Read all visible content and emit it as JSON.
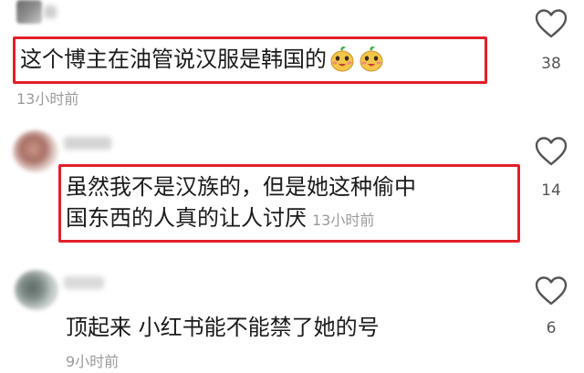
{
  "comments": [
    {
      "text": "这个博主在油管说汉服是韩国的",
      "emoji": [
        "happy-mascot-icon",
        "happy-mascot-icon"
      ],
      "time": "13小时前",
      "likes": "38"
    },
    {
      "line1": "虽然我不是汉族的，但是她这种偷中",
      "line2": "国东西的人真的让人讨厌",
      "time": "13小时前",
      "likes": "14"
    },
    {
      "text": "顶起来 小红书能不能禁了她的号",
      "time": "9小时前",
      "likes": "6"
    }
  ],
  "colors": {
    "highlight_box": "#e2202a",
    "timestamp": "#9a9a9a"
  }
}
